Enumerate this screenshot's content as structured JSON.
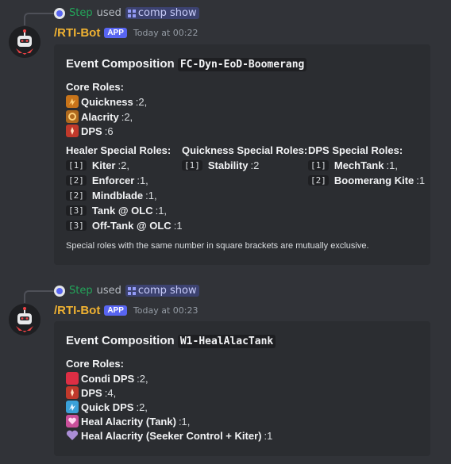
{
  "messages": [
    {
      "reply": {
        "who": "Step",
        "used": "used",
        "command": "comp show"
      },
      "username": "/RTI-Bot",
      "badge": "APP",
      "timestamp": "Today at 00:22",
      "embed": {
        "title": "Event Composition",
        "comp_name": "FC-Dyn-EoD-Boomerang",
        "core_title": "Core Roles:",
        "core": [
          {
            "icon": "quickness-icon",
            "name": "Quickness",
            "value": ":2,"
          },
          {
            "icon": "alacrity-icon",
            "name": "Alacrity",
            "value": ":2,"
          },
          {
            "icon": "dps-icon",
            "name": "DPS",
            "value": ":6"
          }
        ],
        "special_cols": [
          {
            "title": "Healer Special Roles:",
            "items": [
              {
                "tag": "[1]",
                "name": "Kiter",
                "value": ":2,"
              },
              {
                "tag": "[2]",
                "name": "Enforcer",
                "value": ":1,"
              },
              {
                "tag": "[2]",
                "name": "Mindblade",
                "value": ":1,"
              },
              {
                "tag": "[3]",
                "name": "Tank @ OLC",
                "value": ":1,"
              },
              {
                "tag": "[3]",
                "name": "Off-Tank @ OLC",
                "value": ":1"
              }
            ]
          },
          {
            "title": "Quickness Special Roles:",
            "items": [
              {
                "tag": "[1]",
                "name": "Stability",
                "value": ":2"
              }
            ]
          },
          {
            "title": "DPS Special Roles:",
            "items": [
              {
                "tag": "[1]",
                "name": "MechTank",
                "value": ":1,"
              },
              {
                "tag": "[2]",
                "name": "Boomerang Kite",
                "value": ":1"
              }
            ]
          }
        ],
        "footer": "Special roles with the same number in square brackets are mutually exclusive."
      }
    },
    {
      "reply": {
        "who": "Step",
        "used": "used",
        "command": "comp show"
      },
      "username": "/RTI-Bot",
      "badge": "APP",
      "timestamp": "Today at 00:23",
      "embed": {
        "title": "Event Composition",
        "comp_name": "W1-HealAlacTank",
        "core_title": "Core Roles:",
        "core": [
          {
            "icon": "condi-dps-icon",
            "name": "Condi DPS",
            "value": ":2,"
          },
          {
            "icon": "dps-icon",
            "name": "DPS",
            "value": ":4,"
          },
          {
            "icon": "quick-dps-icon",
            "name": "Quick DPS",
            "value": ":2,"
          },
          {
            "icon": "heal-alacrity-tank-icon",
            "name": "Heal Alacrity (Tank)",
            "value": ":1,"
          },
          {
            "icon": "heal-alacrity-seeker-icon",
            "name": "Heal Alacrity (Seeker Control + Kiter)",
            "value": ":1"
          }
        ]
      }
    }
  ],
  "colors": {
    "background": "#313338",
    "embed": "#2b2d31",
    "username": "#f0b232",
    "step": "#23a55a",
    "badge": "#5865f2"
  }
}
